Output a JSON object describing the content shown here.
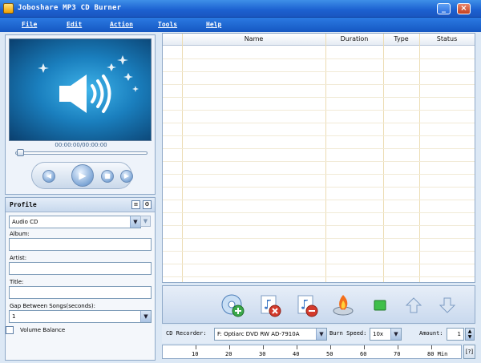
{
  "window": {
    "title": "Joboshare MP3 CD Burner"
  },
  "menu": [
    "File",
    "Edit",
    "Action",
    "Tools",
    "Help"
  ],
  "player": {
    "time": "00:00:00/00:00:00"
  },
  "profile": {
    "title": "Profile",
    "preset": "Audio CD",
    "album_label": "Album:",
    "album_value": "",
    "artist_label": "Artist:",
    "artist_value": "",
    "title_label": "Title:",
    "title_value": "",
    "gap_label": "Gap Between Songs(seconds):",
    "gap_value": "1",
    "volume_label": "Volume Balance"
  },
  "table": {
    "columns": [
      "Name",
      "Duration",
      "Type",
      "Status"
    ],
    "rows": []
  },
  "recorder": {
    "cd_label": "CD Recorder:",
    "cd_value": "F: Optiarc DVD RW AD-7910A",
    "speed_label": "Burn Speed:",
    "speed_value": "10x",
    "amount_label": "Amount:",
    "amount_value": "1"
  },
  "ruler": {
    "ticks": [
      "10",
      "20",
      "30",
      "40",
      "50",
      "60",
      "70",
      "80 Min"
    ]
  },
  "help_label": "[?]",
  "icons": {
    "add": "add-file-icon",
    "remove": "remove-file-icon",
    "clear": "clear-files-icon",
    "burn": "burn-icon",
    "stop": "stop-icon",
    "up": "move-up-icon",
    "down": "move-down-icon"
  }
}
